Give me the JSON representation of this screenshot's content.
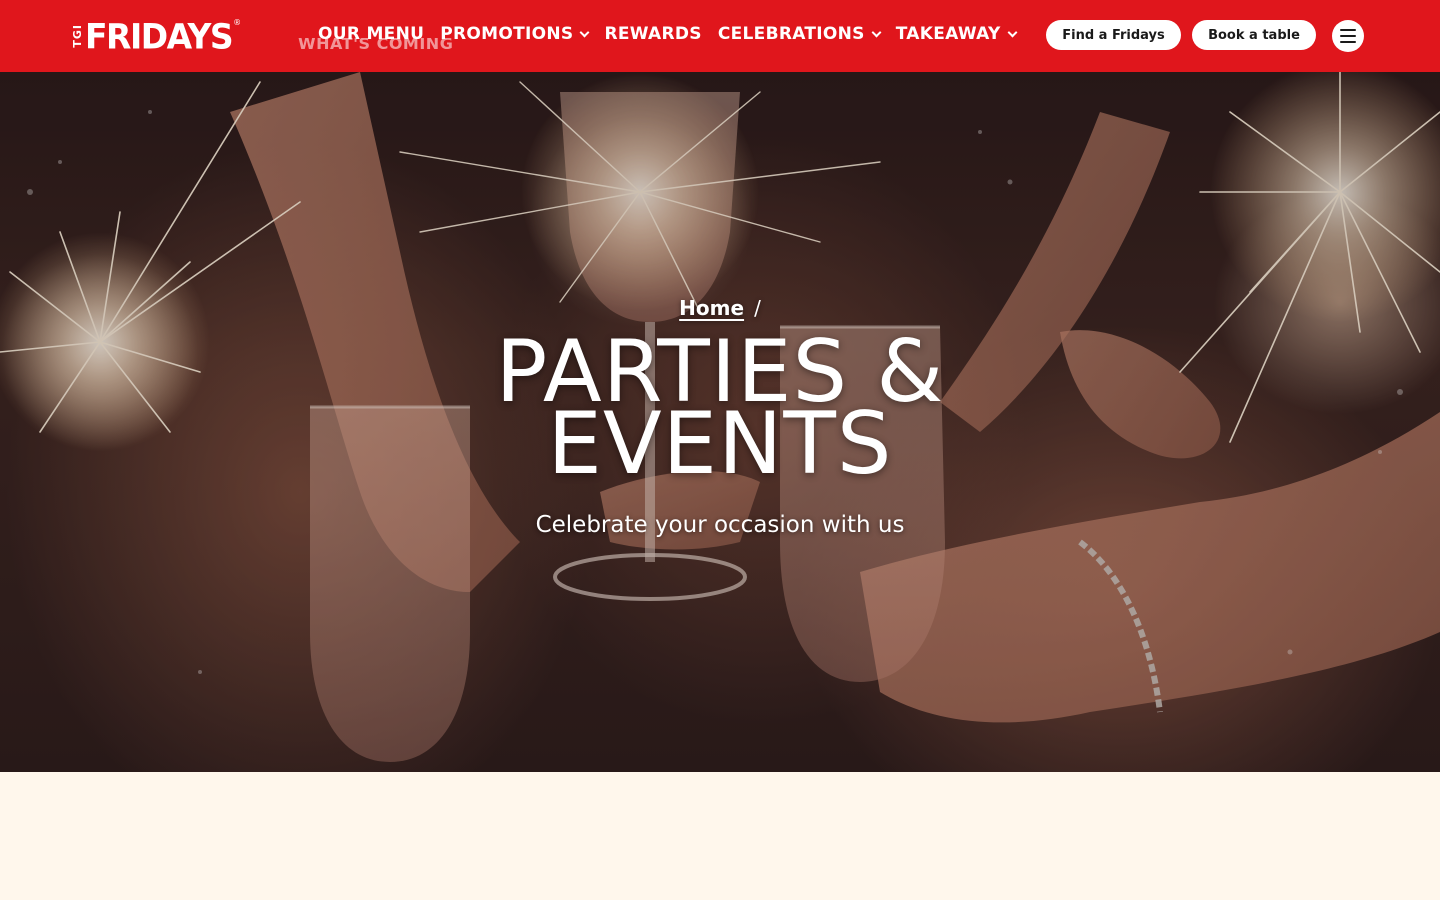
{
  "brand": {
    "logo_prefix": "TGI",
    "logo_text": "FRIDAYS",
    "logo_mark": "®",
    "primary_color": "#e0161c",
    "cream_color": "#fff7ec"
  },
  "header": {
    "ghost_text": "WHAT'S COMING",
    "nav": [
      {
        "label": "OUR MENU",
        "dropdown": false
      },
      {
        "label": "PROMOTIONS",
        "dropdown": true
      },
      {
        "label": "REWARDS",
        "dropdown": false
      },
      {
        "label": "CELEBRATIONS",
        "dropdown": true
      },
      {
        "label": "TAKEAWAY",
        "dropdown": true
      }
    ],
    "find_label": "Find a Fridays",
    "book_label": "Book a table",
    "menu_icon": "hamburger-icon"
  },
  "hero": {
    "breadcrumb_home": "Home",
    "breadcrumb_sep": "/",
    "title_line1": "PARTIES &",
    "title_line2": "EVENTS",
    "subtitle": "Celebrate your occasion with us"
  }
}
